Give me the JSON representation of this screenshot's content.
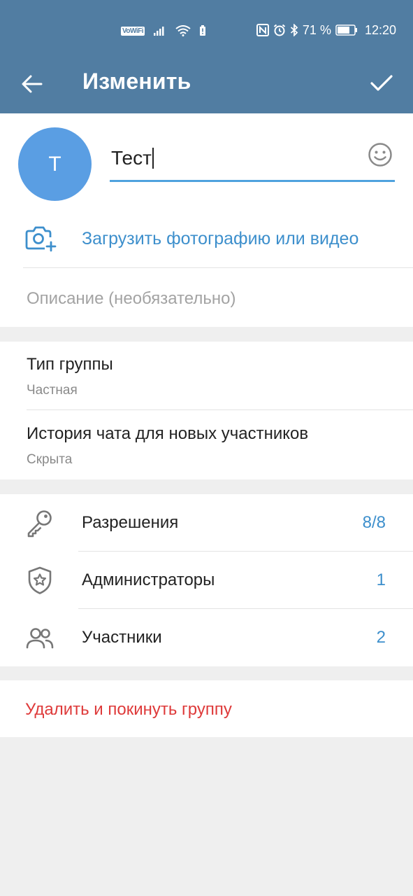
{
  "status_bar": {
    "wifi_badge": "VoWiFi",
    "battery_percent": "71 %",
    "time": "12:20"
  },
  "toolbar": {
    "title": "Изменить"
  },
  "group": {
    "avatar_letter": "Т",
    "avatar_color": "#5a9ee3",
    "name_value": "Тест",
    "upload_label": "Загрузить фотографию или видео",
    "description_placeholder": "Описание (необязательно)"
  },
  "settings": {
    "group_type_title": "Тип группы",
    "group_type_value": "Частная",
    "history_title": "История чата для новых участников",
    "history_value": "Скрыта"
  },
  "list": [
    {
      "label": "Разрешения",
      "count": "8/8",
      "icon": "key-icon"
    },
    {
      "label": "Администраторы",
      "count": "1",
      "icon": "shield-star-icon"
    },
    {
      "label": "Участники",
      "count": "2",
      "icon": "users-icon"
    }
  ],
  "danger": {
    "delete_label": "Удалить и покинуть группу"
  },
  "colors": {
    "header": "#517da2",
    "accent": "#3d8fcc",
    "danger": "#de3a3a",
    "background": "#efefef"
  }
}
